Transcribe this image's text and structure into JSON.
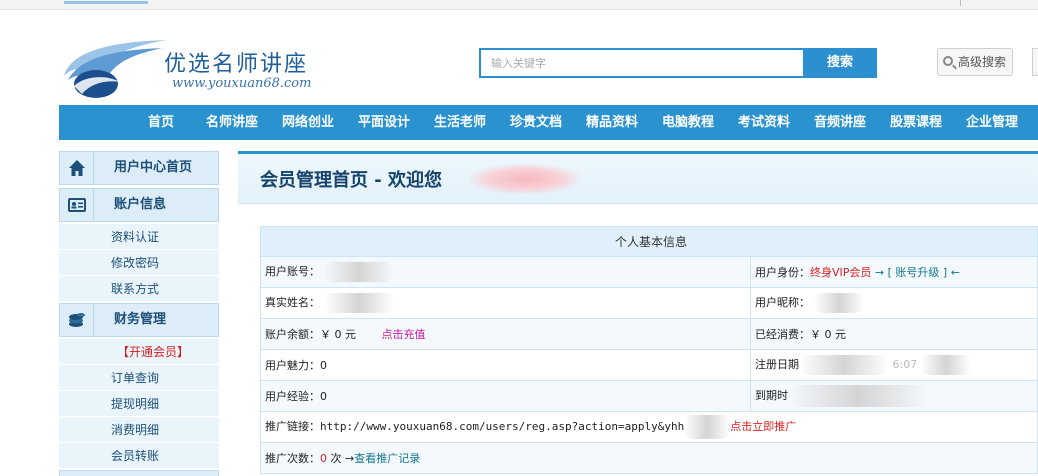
{
  "site": {
    "title": "优选名师讲座",
    "url": "www.youxuan68.com"
  },
  "search": {
    "placeholder": "输入关键字",
    "button": "搜索",
    "advanced": "高级搜索"
  },
  "nav": [
    "首页",
    "名师讲座",
    "网络创业",
    "平面设计",
    "生活老师",
    "珍贵文档",
    "精品资料",
    "电脑教程",
    "考试资料",
    "音频讲座",
    "股票课程",
    "企业管理"
  ],
  "sidebar": {
    "sections": [
      {
        "label": "用户中心首页",
        "icon": "home-icon"
      },
      {
        "label": "账户信息",
        "icon": "id-card-icon",
        "items": [
          "资料认证",
          "修改密码",
          "联系方式"
        ]
      },
      {
        "label": "财务管理",
        "icon": "coins-icon",
        "items": [
          "【开通会员】",
          "订单查询",
          "提现明细",
          "消费明细",
          "会员转账"
        ]
      }
    ]
  },
  "main": {
    "title": "会员管理首页 - 欢迎您",
    "table": {
      "caption": "个人基本信息",
      "account_label": "用户账号：",
      "identity_label": "用户身份：",
      "identity_value": "终身VIP会员",
      "upgrade_prefix": "→ [",
      "upgrade_link": "账号升级",
      "upgrade_suffix": "] ←",
      "realname_label": "真实姓名：",
      "nickname_label": "用户昵称：",
      "balance_label": "账户余额：",
      "balance_value": "￥ 0 元",
      "recharge_link": "点击充值",
      "spent_label": "已经消费：",
      "spent_value": "￥ 0 元",
      "charm_label": "用户魅力：",
      "charm_value": "0",
      "regdate_label": "注册日期",
      "regdate_partial": "6:07",
      "exp_label": "用户经验：",
      "exp_value": "0",
      "expire_label": "到期时",
      "promo_link_label": "推广链接：",
      "promo_link_value": "http://www.youxuan68.com/users/reg.asp?action=apply&yhh",
      "promo_action": "点击立即推广",
      "promo_count_label": "推广次数：",
      "promo_count_value": "0",
      "promo_count_unit": "次",
      "promo_records_prefix": "→",
      "promo_records_link": "查看推广记录"
    }
  },
  "colors": {
    "primary": "#2a93cf",
    "sidebar_bg": "#e9f4fb",
    "vip_red": "#d62020",
    "link_magenta": "#cc19a6",
    "link_teal": "#14768f"
  }
}
